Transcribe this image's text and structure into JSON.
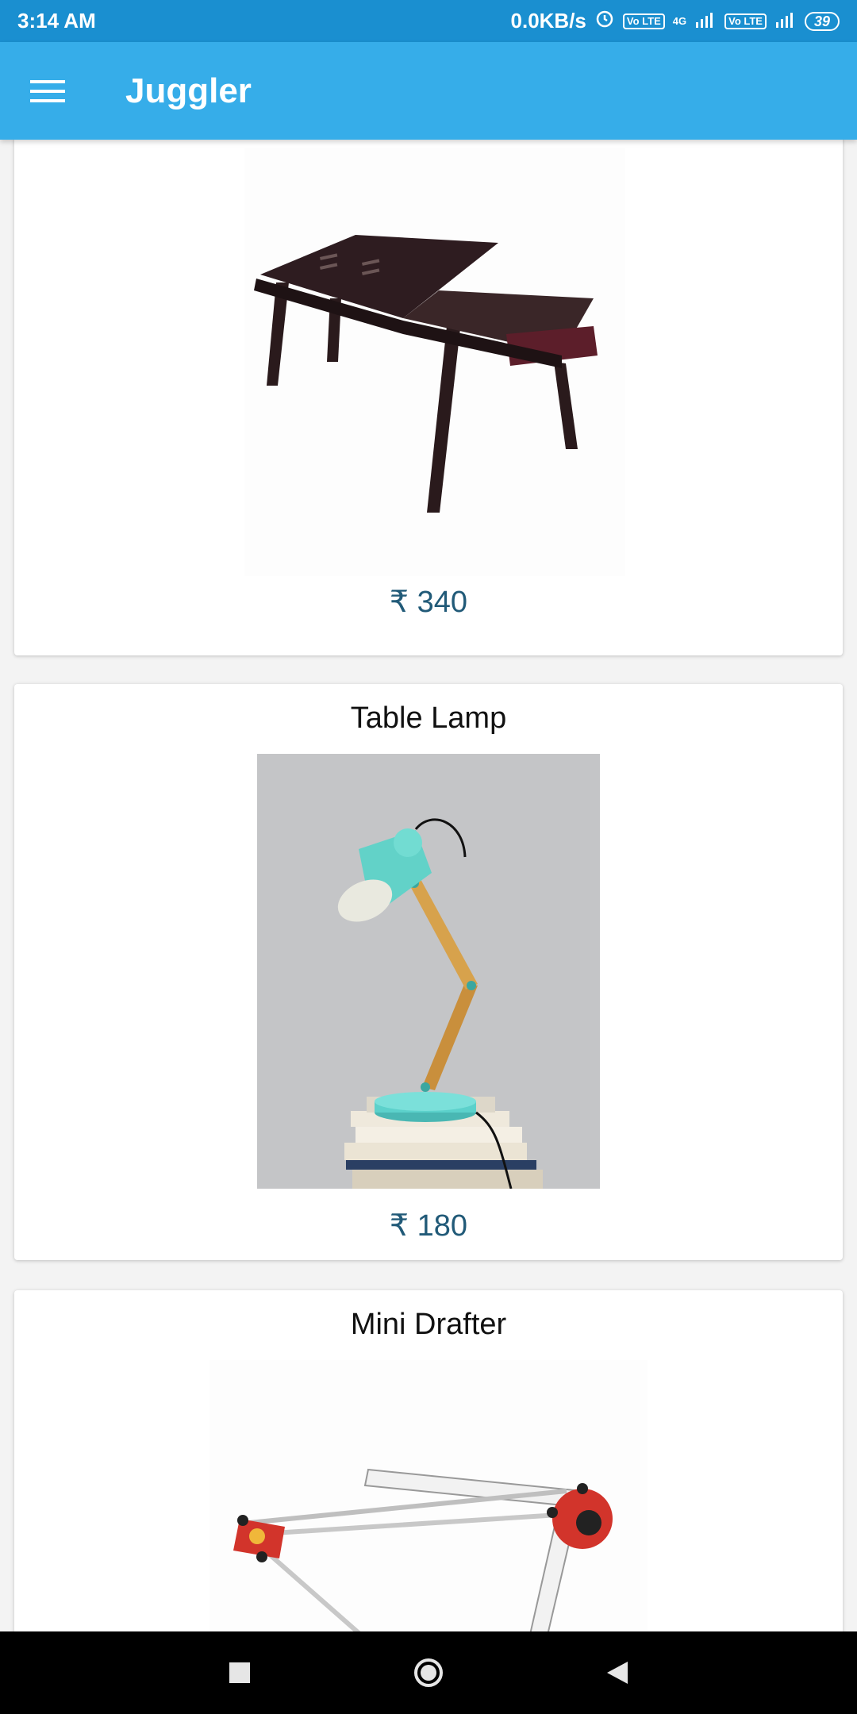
{
  "status_bar": {
    "time": "3:14 AM",
    "network_speed": "0.0KB/s",
    "lte_label": "Vo LTE",
    "network_type": "4G",
    "battery": "39"
  },
  "app_bar": {
    "title": "Juggler",
    "menu_icon": "hamburger-menu-icon"
  },
  "products": [
    {
      "name": "",
      "price": "₹ 340",
      "image": "foldable-laptop-table"
    },
    {
      "name": "Table Lamp",
      "price": "₹ 180",
      "image": "table-lamp"
    },
    {
      "name": "Mini Drafter",
      "price": "",
      "image": "mini-drafter"
    }
  ],
  "nav_bar": {
    "recents_icon": "square-recents-icon",
    "home_icon": "circle-home-icon",
    "back_icon": "triangle-back-icon"
  }
}
